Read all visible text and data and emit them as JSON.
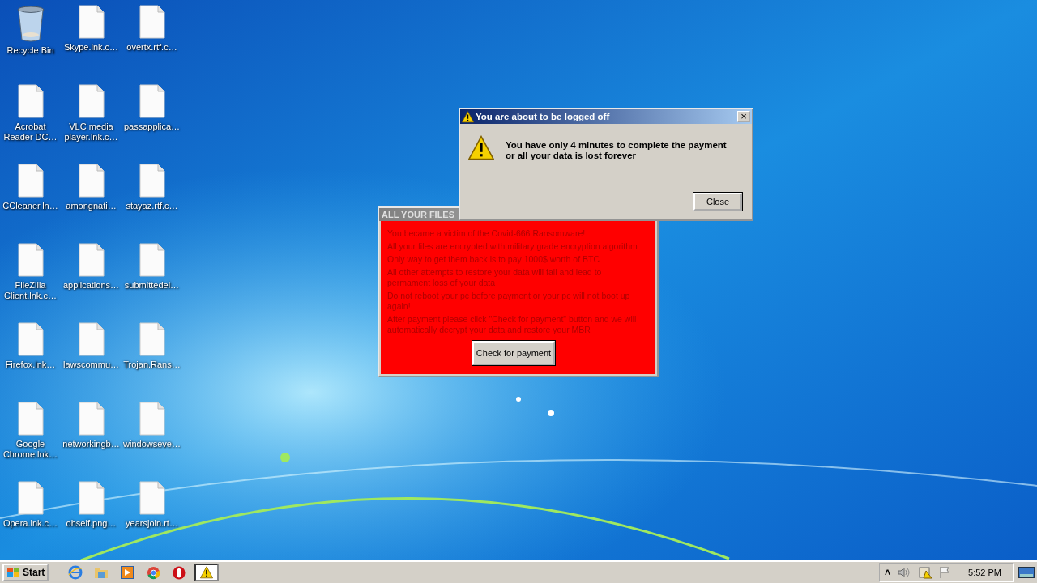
{
  "desktop": {
    "icons": [
      {
        "kind": "recycle",
        "label": "Recycle Bin"
      },
      {
        "kind": "file",
        "label": "Acrobat Reader DC…"
      },
      {
        "kind": "file",
        "label": "CCleaner.ln…"
      },
      {
        "kind": "file",
        "label": "FileZilla Client.lnk.c…"
      },
      {
        "kind": "file",
        "label": "Firefox.lnk…"
      },
      {
        "kind": "file",
        "label": "Google Chrome.lnk…"
      },
      {
        "kind": "file",
        "label": "Opera.lnk.c…"
      },
      {
        "kind": "file",
        "label": "Skype.lnk.c…"
      },
      {
        "kind": "file",
        "label": "VLC media player.lnk.c…"
      },
      {
        "kind": "file",
        "label": "amongnati…"
      },
      {
        "kind": "file",
        "label": "applications…"
      },
      {
        "kind": "file",
        "label": "lawscommu…"
      },
      {
        "kind": "file",
        "label": "networkingb…"
      },
      {
        "kind": "file",
        "label": "ohself.png…"
      },
      {
        "kind": "file",
        "label": "overtx.rtf.c…"
      },
      {
        "kind": "file",
        "label": "passapplica…"
      },
      {
        "kind": "file",
        "label": "stayaz.rtf.c…"
      },
      {
        "kind": "file",
        "label": "submittedel…"
      },
      {
        "kind": "file",
        "label": "Trojan.Rans…"
      },
      {
        "kind": "file",
        "label": "windowseve…"
      },
      {
        "kind": "file",
        "label": "yearsjoin.rt…"
      }
    ]
  },
  "ransom_window": {
    "title": "ALL YOUR FILES",
    "paragraphs": [
      "You became a victim of the Covid-666 Ransomware!",
      "All your files are encrypted with military grade encryption algorithm",
      "Only way to get them back is to pay 1000$ worth of BTC",
      "All other attempts to restore your data will fail and lead to permament loss of your data",
      "Do not reboot your pc before payment or your pc will not boot up again!",
      "After payment please click \"Check for payment\" button and we will automatically decrypt your data and restore your MBR"
    ],
    "button": "Check for payment"
  },
  "dialog": {
    "title": "You are about to be logged off",
    "close_glyph": "×",
    "message": "You have only 4 minutes to complete the payment or all your data is lost forever",
    "button": "Close"
  },
  "taskbar": {
    "start": "Start",
    "apps": [
      {
        "kind": "ie",
        "selected": false
      },
      {
        "kind": "folder",
        "selected": false
      },
      {
        "kind": "media",
        "selected": false
      },
      {
        "kind": "chrome",
        "selected": false
      },
      {
        "kind": "opera",
        "selected": false
      },
      {
        "kind": "warning",
        "selected": true
      }
    ],
    "tray": {
      "chevron": "˄",
      "clock": "5:52 PM"
    }
  }
}
